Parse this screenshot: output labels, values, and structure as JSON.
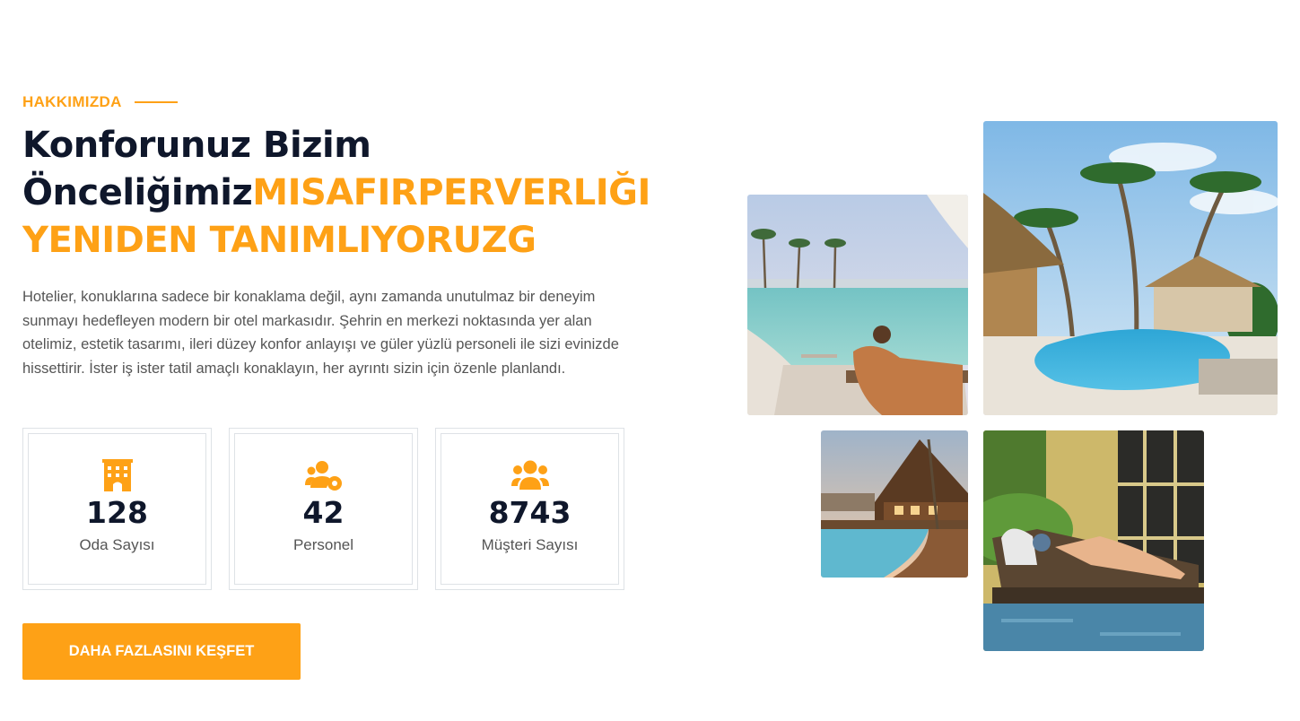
{
  "about": {
    "eyebrow": "HAKKIMIZDA",
    "title_dark": "Konforunuz Bizim Önceliğimiz",
    "title_accent": "MISAFIRPERVERLIĞI YENIDEN TANIMLIYORUZG",
    "description": "Hotelier, konuklarına sadece bir konaklama değil, aynı zamanda unutulmaz bir deneyim sunmayı hedefleyen modern bir otel markasıdır. Şehrin en merkezi noktasında yer alan otelimiz, estetik tasarımı, ileri düzey konfor anlayışı ve güler yüzlü personeli ile sizi evinizde hissettirir. İster iş ister tatil amaçlı konaklayın, her ayrıntı sizin için özenle planlandı."
  },
  "stats": [
    {
      "icon": "hotel-icon",
      "value": "128",
      "label": "Oda Sayısı"
    },
    {
      "icon": "users-cog-icon",
      "value": "42",
      "label": "Personel"
    },
    {
      "icon": "users-icon",
      "value": "8743",
      "label": "Müşteri Sayısı"
    }
  ],
  "cta": {
    "label": "DAHA FAZLASINI KEŞFET"
  },
  "photos": [
    {
      "icon": "pool-lounge-photo"
    },
    {
      "icon": "palm-resort-pool-photo"
    },
    {
      "icon": "wooden-hut-pool-photo"
    },
    {
      "icon": "sunbed-relaxing-photo"
    }
  ],
  "colors": {
    "accent": "#fea116",
    "dark": "#0f172b",
    "text": "#555555",
    "border": "#dee2e6"
  }
}
